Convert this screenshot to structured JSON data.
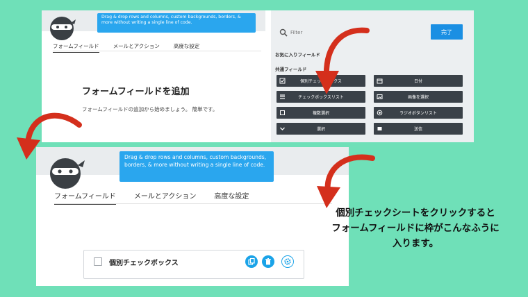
{
  "tooltip": "Drag & drop rows and columns, custom backgrounds, borders, & more without writing a single line of code.",
  "tabs": [
    "フォームフィールド",
    "メールとアクション",
    "高度な設定"
  ],
  "empty_state": {
    "heading": "フォームフィールドを追加",
    "description": "フォームフィールドの追加から始めましょう。 簡単です。"
  },
  "panel": {
    "filter_placeholder": "Filter",
    "done_label": "完了",
    "favorites_label": "お気に入りフィールド",
    "common_label": "共通フィールド",
    "fields": [
      {
        "label": "個別チェックボックス",
        "icon": "checkbox-icon"
      },
      {
        "label": "日付",
        "icon": "calendar-icon"
      },
      {
        "label": "チェックボックスリスト",
        "icon": "list-icon"
      },
      {
        "label": "画像を選択",
        "icon": "image-icon"
      },
      {
        "label": "複数選択",
        "icon": "square-icon"
      },
      {
        "label": "ラジオボタンリスト",
        "icon": "radio-icon"
      },
      {
        "label": "選択",
        "icon": "chevron-down-icon"
      },
      {
        "label": "送信",
        "icon": "submit-icon"
      }
    ]
  },
  "field_card": {
    "label": "個別チェックボックス",
    "actions": [
      "duplicate-icon",
      "trash-icon",
      "gear-icon"
    ]
  },
  "caption": {
    "line1": "個別チェックシートをクリックすると",
    "line2": "フォームフィールドに枠がこんなふうに",
    "line3": "入ります。"
  },
  "colors": {
    "background": "#6fe0b8",
    "accent_blue": "#1a8fe3",
    "tooltip_blue": "#2aa6ee",
    "field_button": "#3a4148",
    "arrow_red": "#d42f1c"
  }
}
